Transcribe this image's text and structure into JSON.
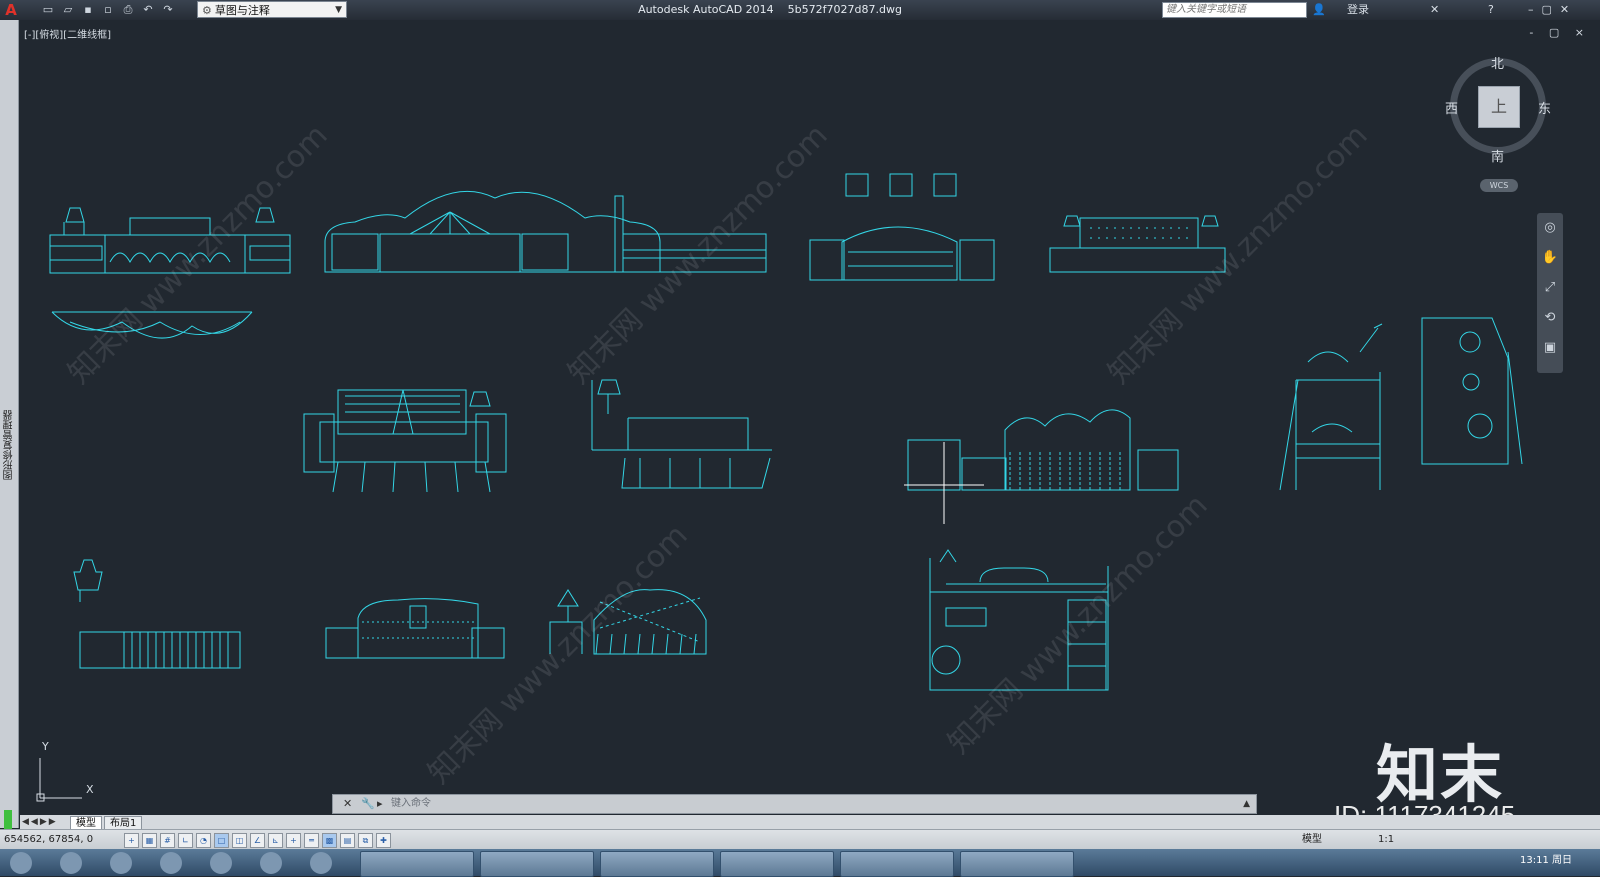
{
  "titlebar": {
    "app_logo": "A",
    "workspace": "草图与注释",
    "title": "Autodesk AutoCAD 2014    5b572f7027d87.dwg",
    "search_placeholder": "键入关键字或短语",
    "login": "登录",
    "help": "?"
  },
  "viewport": {
    "label": "[-][俯视][二维线框]",
    "controls": "- ▢ ×"
  },
  "left_palette": {
    "label": "图形修复管理器"
  },
  "viewcube": {
    "north": "北",
    "south": "南",
    "east": "东",
    "west": "西",
    "face": "上",
    "wcs": "WCS"
  },
  "ucs": {
    "x": "X",
    "y": "Y"
  },
  "command": {
    "placeholder": "键入命令"
  },
  "tabs": [
    {
      "label": "模型"
    },
    {
      "label": "布局1"
    }
  ],
  "status": {
    "coords": "654562, 67854, 0",
    "model": "模型",
    "scale": "1:1"
  },
  "watermark": {
    "text": "知末网 www.znzmo.com",
    "logo": "知末",
    "id": "ID: 1117341245"
  },
  "taskbar": {
    "clock": "13:11 周日"
  },
  "colors": {
    "drawing": "#33d6e6",
    "background": "#212830"
  }
}
